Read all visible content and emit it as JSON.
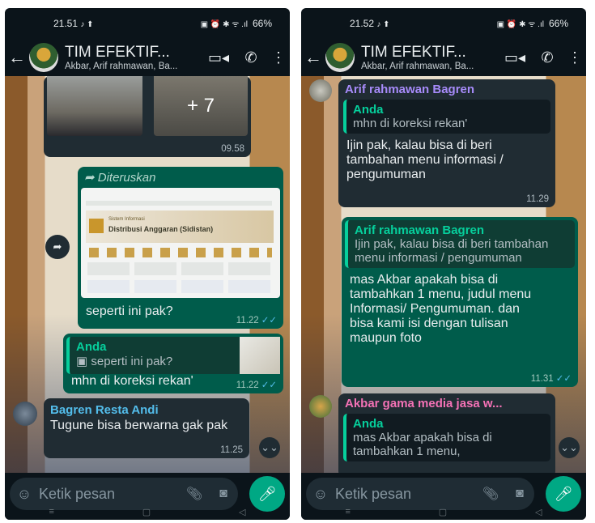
{
  "left": {
    "status": {
      "time": "21.51",
      "extra": "♪ ⬆",
      "icons": "▣ ⏰ ✱ ᯤ .ıl",
      "battery": "66%"
    },
    "header": {
      "title": "TIM EFEKTIF...",
      "subtitle": "Akbar, Arif rahmawan, Ba..."
    },
    "photo_bubble": {
      "more": "+ 7",
      "time": "09.58"
    },
    "forward_bubble": {
      "label": "Diteruskan",
      "image_title": "Sistem Informasi",
      "image_heading": "Distribusi Anggaran (Sidistan)",
      "text": "seperti ini pak?",
      "time": "11.22"
    },
    "reply_bubble": {
      "quote_name": "Anda",
      "quote_text": "seperti ini pak?",
      "text": "mhn di koreksi rekan'",
      "time": "11.22"
    },
    "incoming": {
      "sender": "Bagren Resta Andi",
      "text": "Tugune bisa berwarna gak pak",
      "time": "11.25"
    },
    "composer": {
      "placeholder": "Ketik pesan"
    }
  },
  "right": {
    "status": {
      "time": "21.52",
      "extra": "♪ ⬆",
      "icons": "▣ ⏰ ✱ ᯤ .ıl",
      "battery": "66%"
    },
    "header": {
      "title": "TIM EFEKTIF...",
      "subtitle": "Akbar, Arif rahmawan, Ba..."
    },
    "msg1": {
      "sender": "Arif rahmawan Bagren",
      "quote_name": "Anda",
      "quote_text": "mhn di koreksi rekan'",
      "text": "Ijin pak, kalau bisa di beri tambahan menu informasi / pengumuman",
      "time": "11.29"
    },
    "msg2": {
      "quote_name": "Arif rahmawan Bagren",
      "quote_text": "Ijin pak, kalau bisa di beri tambahan menu informasi / pengumuman",
      "text": "mas Akbar apakah bisa di tambahkan 1 menu, judul menu Informasi/ Pengumuman. dan bisa kami isi dengan tulisan maupun foto",
      "time": "11.31"
    },
    "msg3": {
      "sender": "Akbar gama media jasa w...",
      "quote_name": "Anda",
      "quote_text": "mas Akbar apakah bisa di tambahkan 1 menu,"
    },
    "composer": {
      "placeholder": "Ketik pesan"
    }
  },
  "colors": {
    "outgoing": "#005c4b",
    "incoming": "#202c33",
    "accent": "#00a884",
    "sender_purple": "#a78bfa",
    "sender_pink": "#f472b6",
    "sender_teal": "#06cf9c"
  }
}
